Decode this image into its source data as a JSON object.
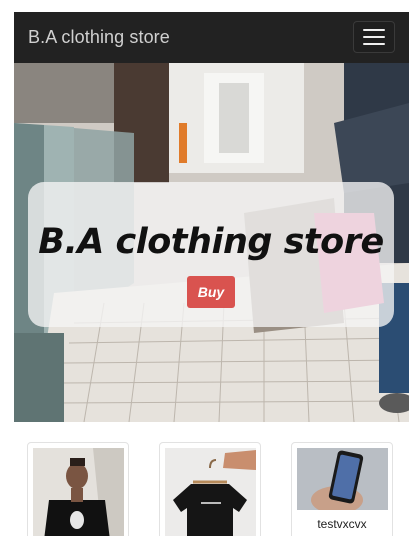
{
  "navbar": {
    "brand": "B.A clothing store",
    "menu_icon": "hamburger-menu-icon"
  },
  "hero": {
    "title": "B.A clothing store",
    "button_label": "Buy"
  },
  "products": [
    {
      "label": "",
      "image": "man-in-black-tshirt-photo"
    },
    {
      "label": "",
      "image": "black-tshirt-on-hanger-photo"
    },
    {
      "label": "testvxcvx",
      "image": "phone-in-hand-photo"
    }
  ],
  "colors": {
    "navbar_bg": "#222222",
    "buy_button": "#d9534f"
  }
}
